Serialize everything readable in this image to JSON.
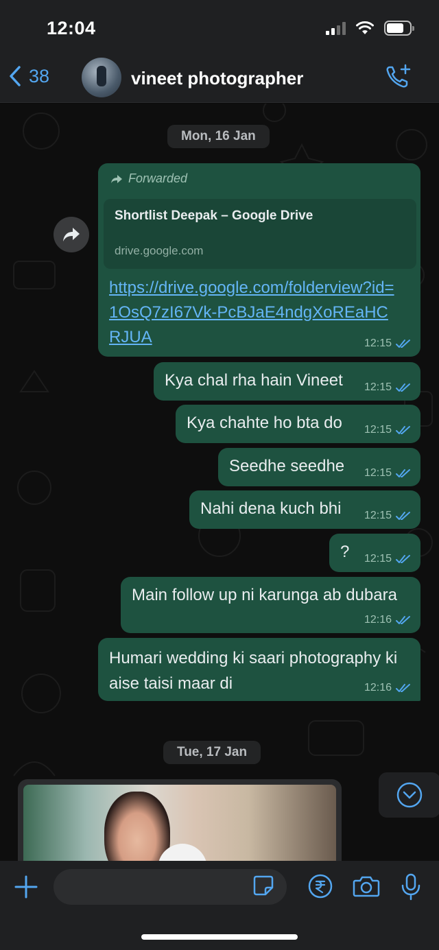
{
  "status": {
    "time": "12:04"
  },
  "header": {
    "back_count": "38",
    "contact_name": "vineet photographer"
  },
  "colors": {
    "accent": "#53a6f0",
    "outgoing_bubble": "#1e5240",
    "link": "#64b5f6"
  },
  "dates": {
    "first": "Mon, 16 Jan",
    "second": "Tue, 17 Jan"
  },
  "forwarded": {
    "label": "Forwarded",
    "preview_title": "Shortlist Deepak – Google Drive",
    "preview_domain": "drive.google.com",
    "link": "https://drive.google.com/folderview?id=1OsQ7zI67Vk-PcBJaE4ndgXoREaHCRJUA",
    "time": "12:15"
  },
  "messages": [
    {
      "text": "Kya chal rha hain Vineet",
      "time": "12:15"
    },
    {
      "text": "Kya chahte ho bta do",
      "time": "12:15"
    },
    {
      "text": "Seedhe seedhe",
      "time": "12:15"
    },
    {
      "text": "Nahi dena kuch bhi",
      "time": "12:15"
    },
    {
      "text": "?",
      "time": "12:15"
    },
    {
      "text": "Main follow up ni karunga ab dubara",
      "time": "12:16"
    },
    {
      "text": "Humari wedding ki saari photography ki aise taisi maar di",
      "time": "12:16"
    }
  ],
  "icons": [
    "back-chevron-icon",
    "add-call-icon",
    "forward-icon",
    "double-check-icon",
    "scroll-down-icon",
    "plus-icon",
    "sticker-icon",
    "rupee-icon",
    "camera-icon",
    "mic-icon"
  ]
}
